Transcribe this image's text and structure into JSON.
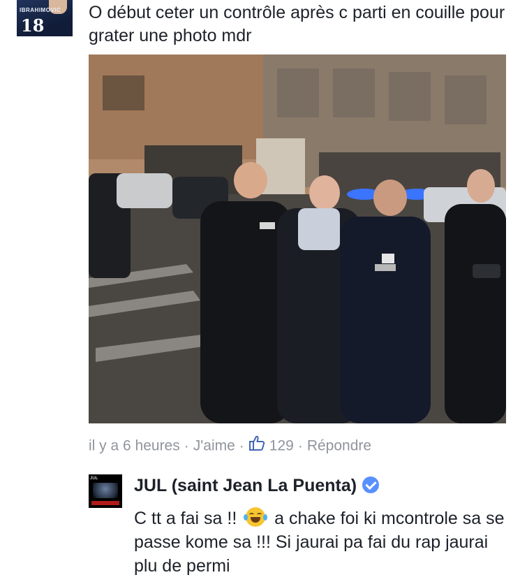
{
  "post_comment": {
    "avatar": {
      "jersey_name": "IBRAHIMOVIC",
      "jersey_number": "18"
    },
    "text": "O début ceter un contrôle après c parti en couille pour grater une  photo mdr",
    "photo_icon": "photo-image",
    "meta": {
      "time": "il y a 6 heures",
      "like_label": "J'aime",
      "like_icon": "thumbs-up-icon",
      "like_count": "129",
      "reply_label": "Répondre",
      "separator": "·"
    }
  },
  "reply": {
    "author": "JUL (saint Jean La Puenta)",
    "verified_icon": "verified-badge-icon",
    "avatar_label": "JUL",
    "text_before_emoji": "C tt a fai sa !! ",
    "emoji": "face-with-tears-of-joy",
    "text_after_emoji": " a chake foi ki mcontrole sa se passe kome sa !!! Si jaurai pa fai du rap jaurai plu de permi"
  },
  "colors": {
    "text": "#1d2129",
    "meta": "#90949c",
    "verified": "#5890ff",
    "like_blue": "#4267b2"
  }
}
